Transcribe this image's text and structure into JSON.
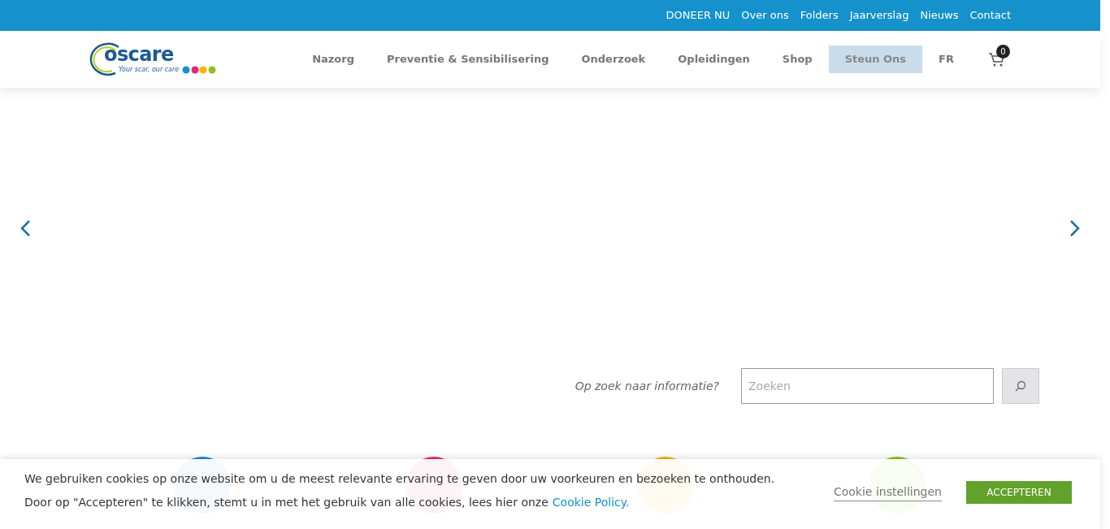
{
  "top_links": [
    "DONEER NU",
    "Over ons",
    "Folders",
    "Jaarverslag",
    "Nieuws",
    "Contact"
  ],
  "logo": {
    "name": "oscare",
    "tagline": "Your scar, our care"
  },
  "nav": [
    {
      "label": "Nazorg",
      "selected": false
    },
    {
      "label": "Preventie & Sensibilisering",
      "selected": false
    },
    {
      "label": "Onderzoek",
      "selected": false
    },
    {
      "label": "Opleidingen",
      "selected": false
    },
    {
      "label": "Shop",
      "selected": false
    },
    {
      "label": "Steun Ons",
      "selected": true
    },
    {
      "label": "FR",
      "selected": false
    }
  ],
  "cart_count": "0",
  "search": {
    "prompt": "Op zoek naar informatie?",
    "placeholder": "Zoeken"
  },
  "cookie_bar": {
    "line_1": "We gebruiken cookies op onze website om u de meest relevante ervaring te geven door uw voorkeuren en bezoeken te onthouden.",
    "line_2": "Door op \"Accepteren\" te klikken, stemt u in met het gebruik van alle cookies, lees hier onze",
    "link": "Cookie Policy.",
    "settings": "Cookie instellingen",
    "accept": "ACCEPTEREN"
  }
}
